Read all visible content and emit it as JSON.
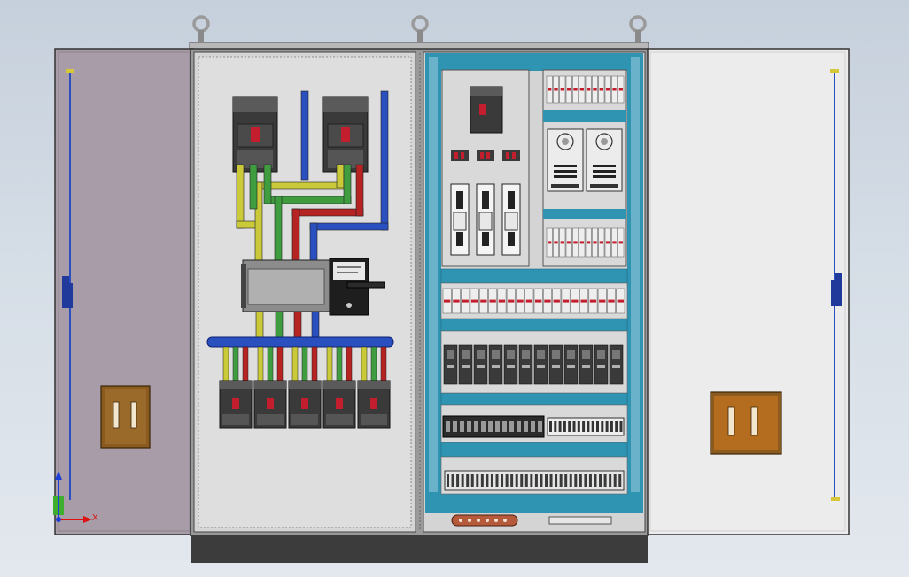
{
  "colors": {
    "background": "#d0d8e2",
    "left_door": "#a59aa5",
    "right_door": "#ececec",
    "panel_gray": "#dcdcdc",
    "din_rail_teal": "#2f93b2",
    "bus_yellow": "#c9c93a",
    "bus_green": "#3f9d3f",
    "bus_red": "#b52323",
    "bus_blue": "#2a4fbf",
    "device_dark": "#3a3a3a",
    "handle_brown": "#8a5a1e",
    "plinth": "#3c3c3c"
  },
  "triad": {
    "x_label": "X",
    "y_label": "Y"
  },
  "icons": {
    "lifting_eye": "lifting-eye-icon",
    "door_handle": "door-handle-icon",
    "hinge": "hinge-icon",
    "latch_rod": "latch-rod-icon"
  }
}
